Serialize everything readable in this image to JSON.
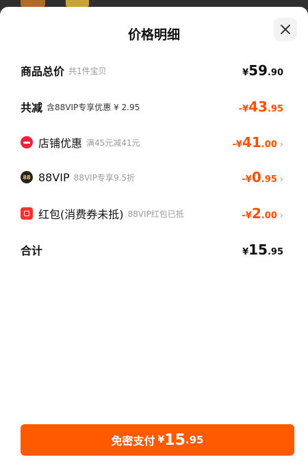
{
  "sheet": {
    "title": "价格明细",
    "close_icon": "close-icon"
  },
  "rows": [
    {
      "label": "商品总价",
      "desc": "共1件宝贝",
      "currency": "¥",
      "integer": "59",
      "decimal": ".90",
      "sign": "",
      "color": "#111111",
      "chevron": false
    },
    {
      "label": "共减",
      "desc": "含88VIP专享优惠 ¥ 2.95",
      "currency": "¥",
      "integer": "43",
      "decimal": ".95",
      "sign": "-",
      "color": "#ff5000",
      "chevron": false
    },
    {
      "label": "店铺优惠",
      "desc": "满45元减41元",
      "currency": "¥",
      "integer": "41",
      "decimal": ".00",
      "sign": "-",
      "color": "#ff5000",
      "chevron": true,
      "icon": "shop-discount-icon"
    },
    {
      "label": "88VIP",
      "desc": "88VIP专享9.5折",
      "currency": "¥",
      "integer": "0",
      "decimal": ".95",
      "sign": "-",
      "color": "#ff5000",
      "chevron": true,
      "icon": "88vip-icon",
      "icon_text": "88"
    },
    {
      "label": "红包(消费券未抵)",
      "desc": "88VIP红包已抵",
      "currency": "¥",
      "integer": "2",
      "decimal": ".00",
      "sign": "-",
      "color": "#ff5000",
      "chevron": true,
      "icon": "red-packet-icon"
    },
    {
      "label": "合计",
      "desc": "",
      "currency": "¥",
      "integer": "15",
      "decimal": ".95",
      "sign": "",
      "color": "#111111",
      "chevron": false
    }
  ],
  "pay_button": {
    "label": "免密支付",
    "currency": "¥",
    "integer": "15",
    "decimal": ".95",
    "color": "#ff5a00"
  },
  "chevron_glyph": "›"
}
